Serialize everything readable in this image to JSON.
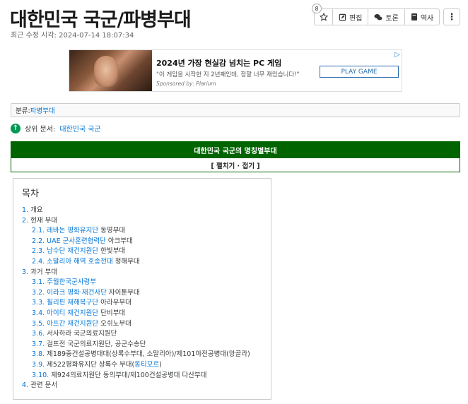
{
  "page": {
    "title": "대한민국 국군/파병부대",
    "last_modified": "최근 수정 시각: 2024-07-14 18:07:34"
  },
  "actions": {
    "star_count": "8",
    "edit": "편집",
    "discuss": "토론",
    "history": "역사",
    "more": "⋮"
  },
  "ad": {
    "title": "2024년 가장 현실감 넘치는 PC 게임",
    "description": "\"이 게임을 시작한 지 2년째인데, 정말 너무 재밌습니다!\"",
    "sponsor": "Sponsored by: Plarium",
    "cta": "PLAY GAME"
  },
  "category": {
    "label": "분류: ",
    "value": "파병부대"
  },
  "parent_doc": {
    "label": "상위 문서: ",
    "link": "대한민국 국군"
  },
  "navbox": {
    "title": "대한민국 국군의 명칭별부대",
    "toggle": "[ 펼치기 · 접기 ]"
  },
  "toc": {
    "title": "목차",
    "items": [
      {
        "num": "1.",
        "link": "",
        "text": "개요",
        "level": 1
      },
      {
        "num": "2.",
        "link": "",
        "text": "현재 부대",
        "level": 1
      },
      {
        "num": "2.1.",
        "link": "레바논 평화유지단",
        "text": " 동명부대",
        "level": 2
      },
      {
        "num": "2.2.",
        "link": "UAE 군사훈련협력단",
        "text": " 아크부대",
        "level": 2
      },
      {
        "num": "2.3.",
        "link": "남수단 재건지원단",
        "text": " 한빛부대",
        "level": 2
      },
      {
        "num": "2.4.",
        "link": "소말리아 해역 호송전대",
        "text": " 청해부대",
        "level": 2
      },
      {
        "num": "3.",
        "link": "",
        "text": "과거 부대",
        "level": 1
      },
      {
        "num": "3.1.",
        "link": "주월한국군사령부",
        "text": "",
        "level": 2
      },
      {
        "num": "3.2.",
        "link": "이라크 평화·재건사단",
        "text": " 자이툰부대",
        "level": 2
      },
      {
        "num": "3.3.",
        "link": "필리핀 재해복구단",
        "text": " 아라우부대",
        "level": 2
      },
      {
        "num": "3.4.",
        "link": "아이티 재건지원단",
        "text": " 단비부대",
        "level": 2
      },
      {
        "num": "3.5.",
        "link": "아프간 재건지원단",
        "text": " 오쉬노부대",
        "level": 2
      },
      {
        "num": "3.6.",
        "link": "",
        "text": "서사하라 국군의료지원단",
        "level": 2
      },
      {
        "num": "3.7.",
        "link": "",
        "text": "걸프전 국군의료지원단, 공군수송단",
        "level": 2
      },
      {
        "num": "3.8.",
        "link": "",
        "text": "제189중건설공병대대(상록수부대, 소말리아)/제101야전공병대(앙골라)",
        "level": 2
      },
      {
        "num": "3.9.",
        "link": "",
        "text": "제522평화유지단 상록수 부대(",
        "link_after": "동티모르",
        "text_after": ")",
        "level": 2
      },
      {
        "num": "3.10.",
        "link": "",
        "text": "제924의료지원단 동의부대/제100건설공병대 다산부대",
        "level": 2
      },
      {
        "num": "4.",
        "link": "",
        "text": "관련 문서",
        "level": 1
      }
    ]
  },
  "icons": {
    "star": "star-icon",
    "edit": "pencil-icon",
    "discuss": "chat-icon",
    "history": "book-icon",
    "up": "arrow-up-circle-icon"
  },
  "colors": {
    "link": "#0275d8",
    "navbox_green": "#006400",
    "up_icon_green": "#009955"
  }
}
